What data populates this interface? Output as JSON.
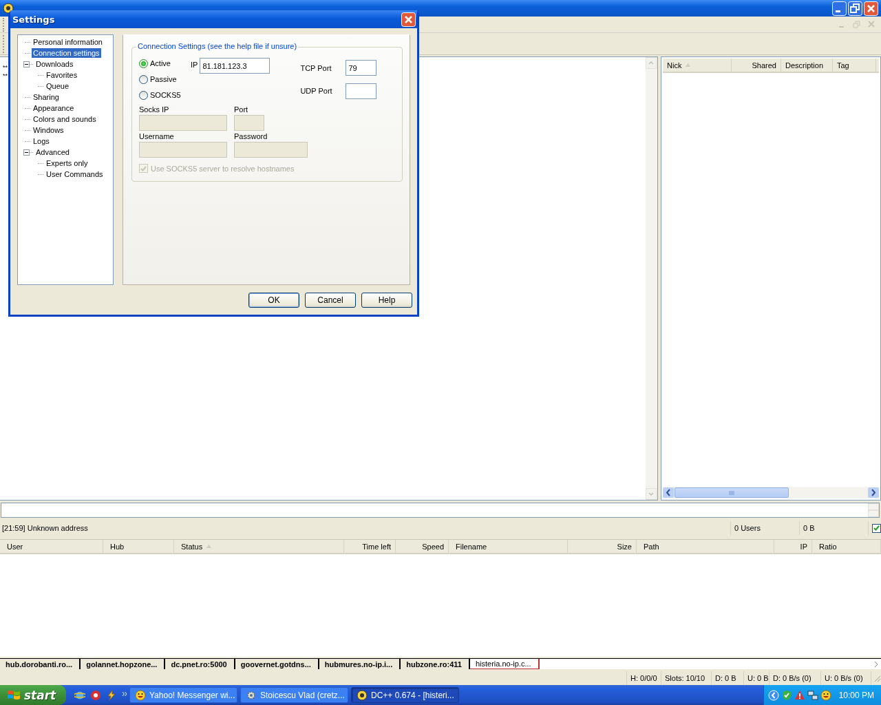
{
  "chat": {
    "lines": [
      "**",
      "**"
    ]
  },
  "user_list": {
    "columns": [
      {
        "label": "Nick",
        "sorted": true
      },
      {
        "label": "Shared",
        "sorted": false
      },
      {
        "label": "Description",
        "sorted": false
      },
      {
        "label": "Tag",
        "sorted": false
      }
    ]
  },
  "status_line": {
    "message": "[21:59] Unknown address",
    "users": "0 Users",
    "size": "0 B",
    "checked": true
  },
  "transfers": {
    "columns": [
      {
        "label": "User",
        "sorted": false
      },
      {
        "label": "Hub",
        "sorted": false
      },
      {
        "label": "Status",
        "sorted": true
      },
      {
        "label": "Time left",
        "sorted": false
      },
      {
        "label": "Speed",
        "sorted": false
      },
      {
        "label": "Filename",
        "sorted": false
      },
      {
        "label": "Size",
        "sorted": false
      },
      {
        "label": "Path",
        "sorted": false
      },
      {
        "label": "IP",
        "sorted": false
      },
      {
        "label": "Ratio",
        "sorted": false
      }
    ]
  },
  "hub_tabs": [
    {
      "label": "hub.dorobanti.ro...",
      "selected": false
    },
    {
      "label": "golannet.hopzone...",
      "selected": false
    },
    {
      "label": "dc.pnet.ro:5000",
      "selected": false
    },
    {
      "label": "goovernet.gotdns...",
      "selected": false
    },
    {
      "label": "hubmures.no-ip.i...",
      "selected": false
    },
    {
      "label": "hubzone.ro:411",
      "selected": false
    },
    {
      "label": "histeria.no-ip.c...",
      "selected": true
    }
  ],
  "status_bar": [
    "H: 0/0/0",
    "Slots: 10/10",
    "D: 0 B",
    "U: 0 B",
    "D: 0 B/s (0)",
    "U: 0 B/s (0)"
  ],
  "settings_dialog": {
    "title": "Settings",
    "tree": [
      {
        "label": "Personal information",
        "selected": false
      },
      {
        "label": "Connection settings",
        "selected": true
      },
      {
        "label": "Downloads",
        "selected": false,
        "expanded": true,
        "children": [
          {
            "label": "Favorites",
            "selected": false
          },
          {
            "label": "Queue",
            "selected": false
          }
        ]
      },
      {
        "label": "Sharing",
        "selected": false
      },
      {
        "label": "Appearance",
        "selected": false
      },
      {
        "label": "Colors and sounds",
        "selected": false
      },
      {
        "label": "Windows",
        "selected": false
      },
      {
        "label": "Logs",
        "selected": false
      },
      {
        "label": "Advanced",
        "selected": false,
        "expanded": true,
        "children": [
          {
            "label": "Experts only",
            "selected": false
          },
          {
            "label": "User Commands",
            "selected": false
          }
        ]
      }
    ],
    "group_title": "Connection Settings (see the help file if unsure)",
    "modes": [
      {
        "label": "Active",
        "selected": true
      },
      {
        "label": "Passive",
        "selected": false
      },
      {
        "label": "SOCKS5",
        "selected": false
      }
    ],
    "ip": {
      "label": "IP",
      "value": "81.181.123.3"
    },
    "tcp_port": {
      "label": "TCP Port",
      "value": "79"
    },
    "udp_port": {
      "label": "UDP Port"
    },
    "socks_ip": {
      "label": "Socks IP"
    },
    "socks_port": {
      "label": "Port"
    },
    "username": {
      "label": "Username"
    },
    "password": {
      "label": "Password"
    },
    "resolve": {
      "label": "Use SOCKS5 server to resolve hostnames",
      "checked": true,
      "disabled": true
    },
    "buttons": [
      "OK",
      "Cancel",
      "Help"
    ]
  },
  "taskbar": {
    "start": "start",
    "tasks": [
      {
        "label": "Yahoo! Messenger wi...",
        "selected": false
      },
      {
        "label": "Stoicescu Vlad (cretz...",
        "selected": false
      },
      {
        "label": "DC++ 0.674 - [histeri...",
        "selected": true
      }
    ],
    "clock": "10:00 PM"
  }
}
